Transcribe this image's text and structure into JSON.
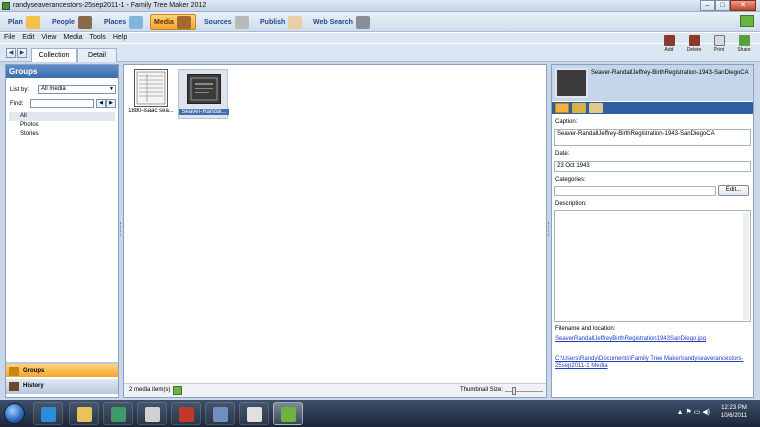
{
  "window": {
    "title": "randyseaverancestors-25sep2011-1 - Family Tree Maker 2012",
    "min": "–",
    "max": "□",
    "close": "✕"
  },
  "workspaces": [
    {
      "label": "Plan"
    },
    {
      "label": "People"
    },
    {
      "label": "Places"
    },
    {
      "label": "Media"
    },
    {
      "label": "Sources"
    },
    {
      "label": "Publish"
    },
    {
      "label": "Web Search"
    }
  ],
  "menu": [
    "File",
    "Edit",
    "View",
    "Media",
    "Tools",
    "Help"
  ],
  "subtabs": {
    "back": "◀",
    "forward": "▶",
    "collection": "Collection",
    "detail": "Detail"
  },
  "toolbar": {
    "add": "Add",
    "delete": "Delete",
    "print": "Print",
    "share": "Share"
  },
  "left": {
    "header": "Groups",
    "list_by_label": "List by:",
    "list_by_value": "All media",
    "find_label": "Find:",
    "find_prev": "◀",
    "find_next": "▶",
    "groups": [
      "All",
      "Photos",
      "Stories"
    ],
    "groups_button": "Groups",
    "history_button": "History"
  },
  "center": {
    "items": [
      {
        "caption": "1880-isaac sea..."
      },
      {
        "caption": "Seaver-Randal..."
      }
    ],
    "count": "2 media item(s)",
    "thumbnail_size_label": "Thumbnail Size:"
  },
  "right": {
    "title": "Seaver-RandallJeffrey-BirthRegistration-1943-SanDiegoCA",
    "caption_label": "Caption:",
    "caption_value": "Seaver-RandallJeffrey-BirthRegistration-1943-SanDiegoCA",
    "date_label": "Date:",
    "date_value": "23 Oct 1943",
    "categories_label": "Categories:",
    "edit_button": "Edit...",
    "description_label": "Description:",
    "filename_label": "Filename and location:",
    "filename_value": "SeaverRandallJeffreyBirthRegistration1943SanDiego.jpg",
    "location_value": "C:\\Users\\Randy\\Documents\\Family Tree Maker\\randyseaverancestors-25sep2011-1 Media"
  },
  "taskbar": {
    "time": "12:23 PM",
    "date": "10/6/2011"
  },
  "colors": {
    "accent": "#f2a42b",
    "header_blue": "#3e6eab",
    "link": "#1f3fbf"
  }
}
